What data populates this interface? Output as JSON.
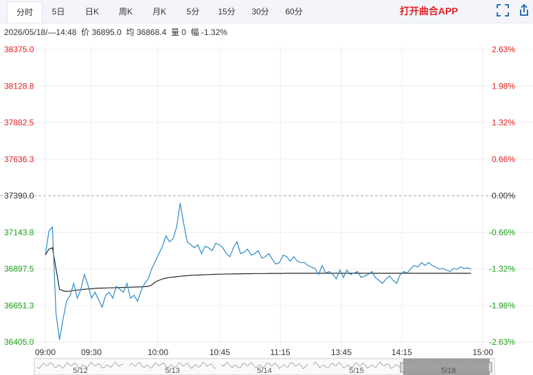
{
  "tabs": [
    {
      "label": "分时",
      "active": true
    },
    {
      "label": "5日",
      "active": false
    },
    {
      "label": "日K",
      "active": false
    },
    {
      "label": "周K",
      "active": false
    },
    {
      "label": "月K",
      "active": false
    },
    {
      "label": "5分",
      "active": false
    },
    {
      "label": "15分",
      "active": false
    },
    {
      "label": "30分",
      "active": false
    },
    {
      "label": "60分",
      "active": false
    }
  ],
  "app_link": "打开曲合APP",
  "info": {
    "datetime": "2026/05/18/—14:48",
    "price_label": "价",
    "price": "36895.0",
    "avg_label": "均",
    "avg": "36868.4",
    "vol_label": "量",
    "vol": "0",
    "pct_label": "幅",
    "pct": "-1.32%"
  },
  "colors": {
    "up": "#e02020",
    "down": "#1aa01a",
    "price_line": "#2c8ac4",
    "avg_line": "#222222",
    "grid": "#eeeeee",
    "tab_bg": "#f3f5fa",
    "nav_mask": "#8d8d8d"
  },
  "chart_data": {
    "type": "line",
    "title": "",
    "xlabel": "",
    "ylabel": "",
    "prev_close": 37390.0,
    "ylim": [
      36405.0,
      38375.0
    ],
    "yticks_left": [
      "38375.0",
      "38128.8",
      "37882.5",
      "37636.3",
      "37390.0",
      "37143.8",
      "36897.5",
      "36651.3",
      "36405.0"
    ],
    "yticks_right": [
      "2.63%",
      "1.98%",
      "1.32%",
      "0.66%",
      "0.00%",
      "-0.66%",
      "-1.32%",
      "-1.98%",
      "-2.63%"
    ],
    "xticks": [
      "09:00",
      "09:30",
      "10:00",
      "10:45",
      "11:15",
      "13:45",
      "14:15",
      "15:00"
    ],
    "series": [
      {
        "x": [
          0,
          2,
          4,
          6,
          8,
          10,
          12,
          14,
          16,
          18,
          20,
          22,
          24,
          26,
          28,
          30,
          32,
          34,
          36,
          38,
          40,
          42,
          44,
          46,
          48,
          50,
          52,
          54,
          56,
          58,
          60,
          62,
          64,
          66,
          68,
          70,
          72,
          74,
          76,
          78,
          80,
          82,
          84,
          86,
          88,
          90,
          92,
          94,
          96,
          98,
          100,
          102,
          104,
          106,
          108,
          110,
          112,
          114,
          116,
          118,
          120,
          122,
          124,
          126,
          128,
          130,
          132,
          134,
          136,
          138,
          140,
          142,
          144,
          146,
          148,
          150,
          152,
          154,
          156,
          158,
          160,
          162,
          164,
          166,
          168,
          170,
          172,
          174,
          176,
          178,
          180,
          182,
          184,
          186,
          188,
          190,
          192,
          194,
          196,
          198,
          200,
          202,
          204,
          206,
          208,
          210,
          212,
          214,
          216,
          218,
          220,
          222,
          224,
          226,
          228,
          230,
          232,
          234,
          236,
          238,
          240
        ],
        "values": [
          36990,
          37150,
          37180,
          36600,
          36420,
          36560,
          36680,
          36720,
          36800,
          36700,
          36760,
          36860,
          36790,
          36700,
          36740,
          36690,
          36640,
          36720,
          36740,
          36700,
          36780,
          36760,
          36740,
          36800,
          36700,
          36720,
          36680,
          36750,
          36800,
          36830,
          36900,
          36950,
          37000,
          37050,
          37120,
          37080,
          37100,
          37180,
          37340,
          37200,
          37080,
          37060,
          37040,
          37060,
          37000,
          37050,
          37040,
          37020,
          37070,
          37060,
          37040,
          37000,
          36980,
          37040,
          37080,
          37000,
          37010,
          37030,
          36990,
          37000,
          37020,
          36970,
          36980,
          37000,
          36960,
          36930,
          36940,
          36990,
          36980,
          36950,
          36980,
          36950,
          36940,
          36940,
          36920,
          36910,
          36900,
          36860,
          36920,
          36870,
          36880,
          36860,
          36830,
          36890,
          36840,
          36890,
          36860,
          36870,
          36880,
          36840,
          36850,
          36860,
          36880,
          36840,
          36820,
          36800,
          36830,
          36850,
          36820,
          36800,
          36860,
          36880,
          36870,
          36900,
          36920,
          36910,
          36940,
          36920,
          36940,
          36920,
          36910,
          36895,
          36900,
          36890,
          36880,
          36900,
          36895,
          36910,
          36900,
          36905,
          36895
        ]
      },
      {
        "x": [
          0,
          2,
          4,
          6,
          8,
          10,
          12,
          14,
          16,
          18,
          20,
          22,
          24,
          26,
          28,
          30,
          32,
          34,
          36,
          38,
          40,
          42,
          44,
          46,
          48,
          50,
          52,
          54,
          56,
          58,
          60,
          62,
          64,
          66,
          68,
          70,
          72,
          74,
          76,
          78,
          80,
          82,
          84,
          86,
          88,
          90,
          92,
          94,
          96,
          98,
          100,
          102,
          104,
          106,
          108,
          110,
          112,
          114,
          116,
          118,
          120,
          122,
          124,
          126,
          128,
          130,
          132,
          134,
          136,
          138,
          140,
          142,
          144,
          146,
          148,
          150,
          152,
          154,
          156,
          158,
          160,
          162,
          164,
          166,
          168,
          170,
          172,
          174,
          176,
          178,
          180,
          182,
          184,
          186,
          188,
          190,
          192,
          194,
          196,
          198,
          200,
          202,
          204,
          206,
          208,
          210,
          212,
          214,
          216,
          218,
          220,
          222,
          224,
          226,
          228,
          230,
          232,
          234,
          236,
          238,
          240
        ],
        "values": [
          36990,
          37030,
          37040,
          36900,
          36760,
          36750,
          36745,
          36748,
          36752,
          36755,
          36758,
          36760,
          36762,
          36764,
          36766,
          36768,
          36768,
          36769,
          36770,
          36770,
          36771,
          36772,
          36772,
          36773,
          36774,
          36775,
          36776,
          36776,
          36778,
          36780,
          36790,
          36810,
          36820,
          36830,
          36835,
          36840,
          36842,
          36845,
          36848,
          36850,
          36852,
          36854,
          36855,
          36856,
          36857,
          36858,
          36859,
          36860,
          36861,
          36862,
          36862,
          36863,
          36863,
          36864,
          36864,
          36864,
          36865,
          36865,
          36865,
          36866,
          36866,
          36866,
          36866,
          36867,
          36867,
          36867,
          36867,
          36867,
          36868,
          36868,
          36868,
          36868,
          36868,
          36868,
          36868,
          36868,
          36868,
          36868,
          36868,
          36868,
          36868,
          36868,
          36868,
          36868,
          36868,
          36868,
          36868,
          36868,
          36868,
          36868,
          36868,
          36868,
          36868,
          36868,
          36868,
          36868,
          36868,
          36868,
          36868,
          36868,
          36868,
          36868,
          36868,
          36868,
          36868,
          36868,
          36868,
          36868,
          36868,
          36868,
          36868,
          36868,
          36868,
          36868,
          36868,
          36868,
          36868,
          36868,
          36868,
          36868,
          36868.4
        ]
      }
    ],
    "navigator": {
      "labels": [
        "5/12",
        "5/13",
        "5/14",
        "5/15",
        "5/18"
      ],
      "selected": "5/18"
    }
  }
}
